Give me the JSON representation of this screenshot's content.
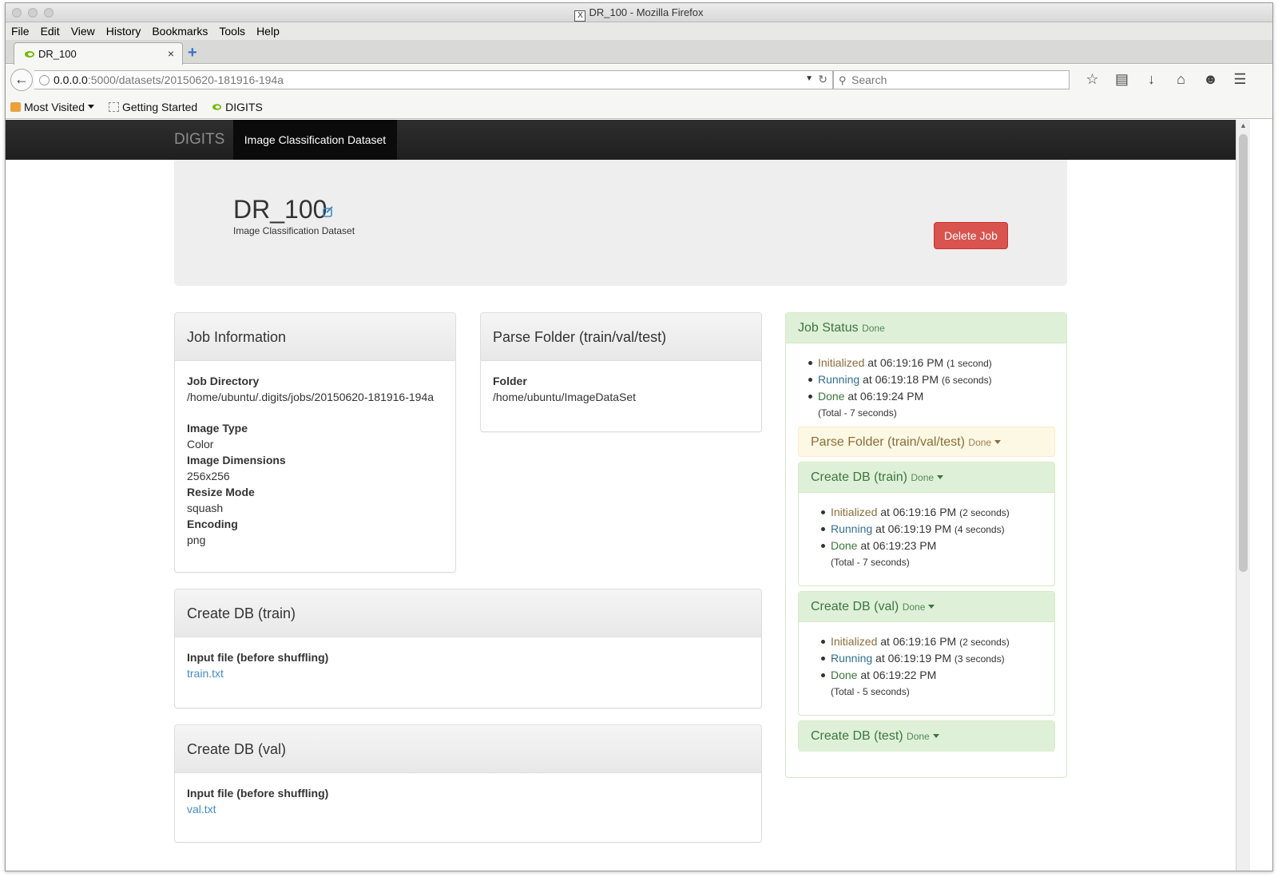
{
  "window": {
    "title": "DR_100 - Mozilla Firefox"
  },
  "menubar": [
    "File",
    "Edit",
    "View",
    "History",
    "Bookmarks",
    "Tools",
    "Help"
  ],
  "tab": {
    "label": "DR_100",
    "close": "×"
  },
  "nav": {
    "url_host": "0.0.0.0",
    "url_path": ":5000/datasets/20150620-181916-194a",
    "search_placeholder": "Search"
  },
  "bookmarks": [
    {
      "label": "Most Visited",
      "icon": "folder-icon"
    },
    {
      "label": "Getting Started",
      "icon": "page-icon"
    },
    {
      "label": "DIGITS",
      "icon": "nvidia-icon"
    }
  ],
  "topnav": {
    "brand": "DIGITS",
    "active": "Image Classification Dataset"
  },
  "job": {
    "name": "DR_100",
    "type": "Image Classification Dataset",
    "delete_label": "Delete Job"
  },
  "job_info": {
    "title": "Job Information",
    "fields": [
      {
        "label": "Job Directory",
        "value": "/home/ubuntu/.digits/jobs/20150620-181916-194a"
      },
      {
        "label": "Image Type",
        "value": "Color"
      },
      {
        "label": "Image Dimensions",
        "value": "256x256"
      },
      {
        "label": "Resize Mode",
        "value": "squash"
      },
      {
        "label": "Encoding",
        "value": "png"
      }
    ]
  },
  "parse_folder": {
    "title": "Parse Folder (train/val/test)",
    "label": "Folder",
    "value": "/home/ubuntu/ImageDataSet"
  },
  "create_train": {
    "title": "Create DB (train)",
    "label": "Input file (before shuffling)",
    "link": "train.txt"
  },
  "create_val": {
    "title": "Create DB (val)",
    "label": "Input file (before shuffling)",
    "link": "val.txt"
  },
  "status": {
    "title": "Job Status",
    "state": "Done",
    "timeline": [
      {
        "state": "Initialized",
        "time": "at 06:19:16 PM",
        "dur": "(1 second)"
      },
      {
        "state": "Running",
        "time": "at 06:19:18 PM",
        "dur": "(6 seconds)"
      },
      {
        "state": "Done",
        "time": "at 06:19:24 PM",
        "dur": ""
      }
    ],
    "total": "(Total - 7 seconds)",
    "tasks": [
      {
        "title": "Parse Folder (train/val/test)",
        "state": "Done"
      },
      {
        "title": "Create DB (train)",
        "state": "Done",
        "timeline": [
          {
            "state": "Initialized",
            "time": "at 06:19:16 PM",
            "dur": "(2 seconds)"
          },
          {
            "state": "Running",
            "time": "at 06:19:19 PM",
            "dur": "(4 seconds)"
          },
          {
            "state": "Done",
            "time": "at 06:19:23 PM",
            "dur": ""
          }
        ],
        "total": "(Total - 7 seconds)"
      },
      {
        "title": "Create DB (val)",
        "state": "Done",
        "timeline": [
          {
            "state": "Initialized",
            "time": "at 06:19:16 PM",
            "dur": "(2 seconds)"
          },
          {
            "state": "Running",
            "time": "at 06:19:19 PM",
            "dur": "(3 seconds)"
          },
          {
            "state": "Done",
            "time": "at 06:19:22 PM",
            "dur": ""
          }
        ],
        "total": "(Total - 5 seconds)"
      },
      {
        "title": "Create DB (test)",
        "state": "Done"
      }
    ]
  },
  "colors": {
    "accent": "#428bca",
    "danger": "#d9534f",
    "success_bg": "#dff0d8",
    "warning_bg": "#fcf8e3",
    "navbar": "#222222"
  }
}
